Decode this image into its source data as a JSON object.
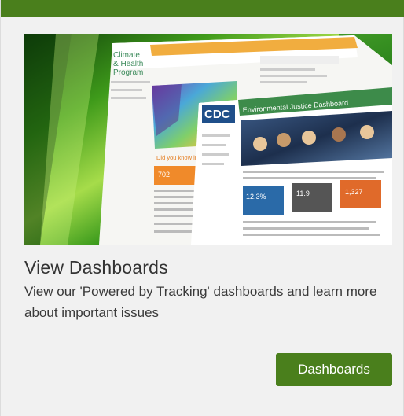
{
  "card": {
    "title": "View Dashboards",
    "description": "View our 'Powered by Tracking' dashboards and learn more about important issues",
    "button_label": "Dashboards"
  },
  "colors": {
    "brand_green": "#4a7f1c",
    "card_background": "#f1f1f1"
  },
  "hero_image": {
    "logo_text": [
      "Climate",
      "& Health",
      "Program"
    ],
    "cdc_logo": "CDC",
    "dashboard_title": "Environmental Justice Dashboard",
    "map_question": "Did you know in the United",
    "stat_values": [
      "702",
      "12.3%",
      "11.9",
      "1,327"
    ]
  }
}
